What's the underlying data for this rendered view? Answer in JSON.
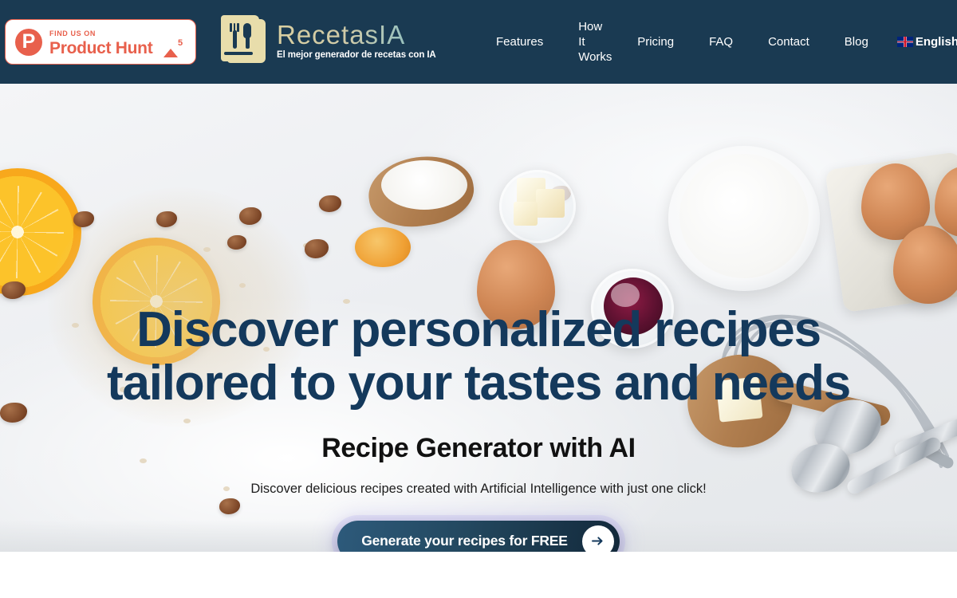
{
  "header": {
    "background_color": "#1a3a52",
    "product_hunt": {
      "name": "product-hunt-badge",
      "logo_letter": "P",
      "find_us_on": "FIND US ON",
      "title": "Product Hunt",
      "upvote_count": "5",
      "accent_color": "#e8604c"
    },
    "brand": {
      "name": "RecetasIA",
      "tagline": "El mejor generador de recetas con IA",
      "icon": "recipe-book-icon"
    },
    "nav": [
      {
        "label": "Features",
        "wrap": false
      },
      {
        "label": "How It Works",
        "wrap": true
      },
      {
        "label": "Pricing",
        "wrap": false
      },
      {
        "label": "FAQ",
        "wrap": false
      },
      {
        "label": "Contact",
        "wrap": false
      },
      {
        "label": "Blog",
        "wrap": false
      }
    ],
    "language": {
      "flag": "uk-flag-icon",
      "label": "English"
    }
  },
  "hero": {
    "headline_line1": "Discover personalized recipes",
    "headline_line2": "tailored to your tastes and needs",
    "headline_color": "#14395c",
    "subheading": "Recipe Generator with AI",
    "description": "Discover delicious recipes created with Artificial Intelligence with just one click!",
    "cta": {
      "label": "Generate your recipes for FREE",
      "icon": "arrow-right-icon"
    },
    "background_photo": "baking-ingredients-flatlay"
  }
}
